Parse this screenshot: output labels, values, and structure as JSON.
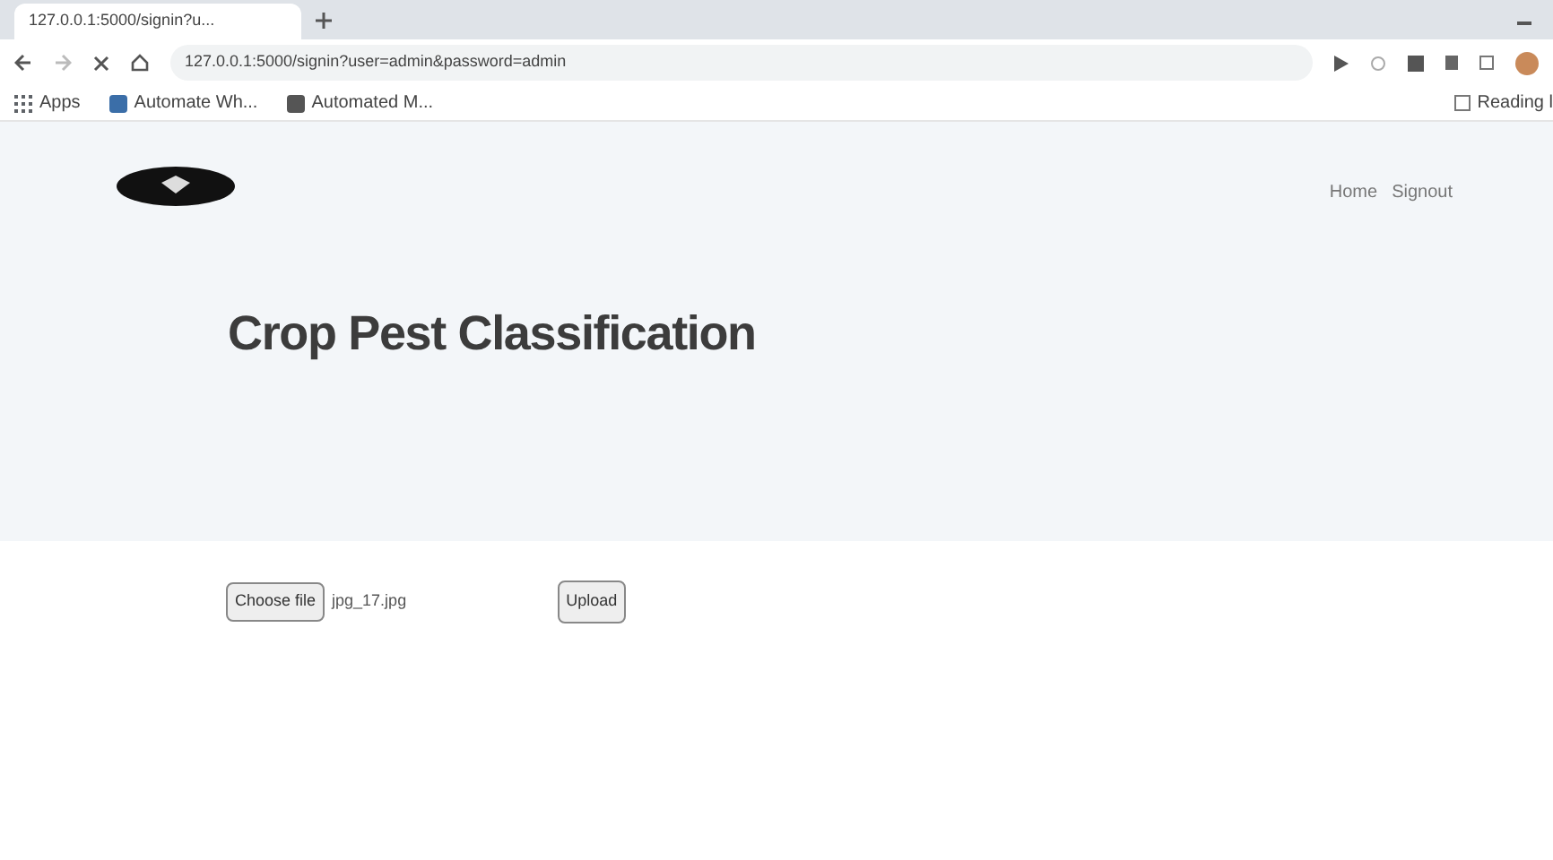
{
  "browser": {
    "tab": {
      "title": "127.0.0.1:5000/signin?u..."
    },
    "url": "127.0.0.1:5000/signin?user=admin&password=admin",
    "bookmarks": [
      "Apps",
      "Automate Wh...",
      "Automated M..."
    ],
    "reading_list": "Reading l"
  },
  "header": {
    "nav": [
      "Home",
      "Signout"
    ],
    "title": "Crop Pest Classification"
  },
  "form": {
    "file_button": "Choose file",
    "file_name": "jpg_17.jpg",
    "submit": "Upload"
  }
}
